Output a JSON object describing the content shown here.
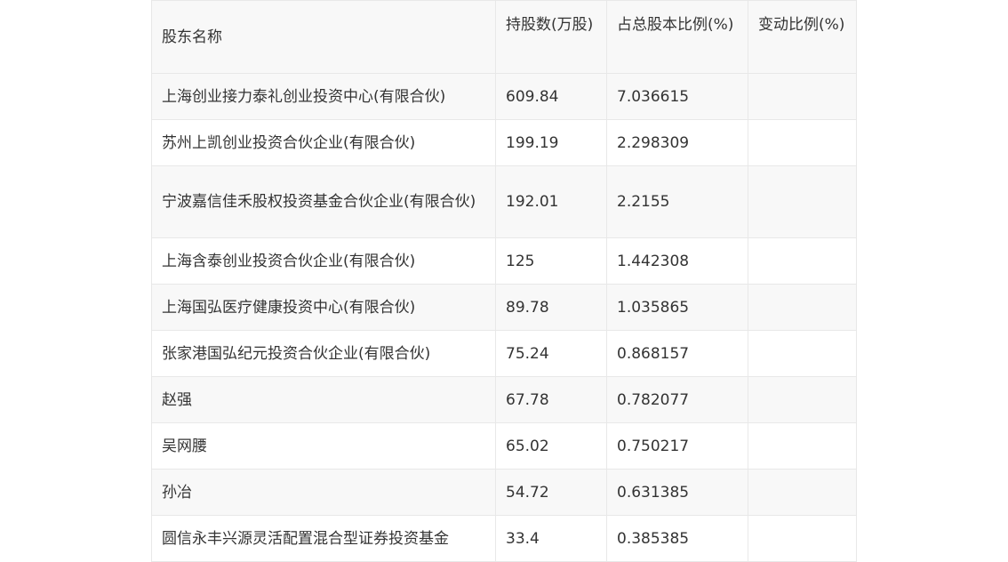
{
  "table": {
    "headers": [
      "股东名称",
      "持股数(万股)",
      "占总股本比例(%)",
      "变动比例(%)"
    ],
    "rows": [
      [
        "上海创业接力泰礼创业投资中心(有限合伙)",
        "609.84",
        "7.036615",
        ""
      ],
      [
        "苏州上凯创业投资合伙企业(有限合伙)",
        "199.19",
        "2.298309",
        ""
      ],
      [
        "宁波嘉信佳禾股权投资基金合伙企业(有限合伙)",
        "192.01",
        "2.2155",
        ""
      ],
      [
        "上海含泰创业投资合伙企业(有限合伙)",
        "125",
        "1.442308",
        ""
      ],
      [
        "上海国弘医疗健康投资中心(有限合伙)",
        "89.78",
        "1.035865",
        ""
      ],
      [
        "张家港国弘纪元投资合伙企业(有限合伙)",
        "75.24",
        "0.868157",
        ""
      ],
      [
        "赵强",
        "67.78",
        "0.782077",
        ""
      ],
      [
        "吴网腰",
        "65.02",
        "0.750217",
        ""
      ],
      [
        "孙冶",
        "54.72",
        "0.631385",
        ""
      ],
      [
        "圆信永丰兴源灵活配置混合型证券投资基金",
        "33.4",
        "0.385385",
        ""
      ]
    ]
  }
}
